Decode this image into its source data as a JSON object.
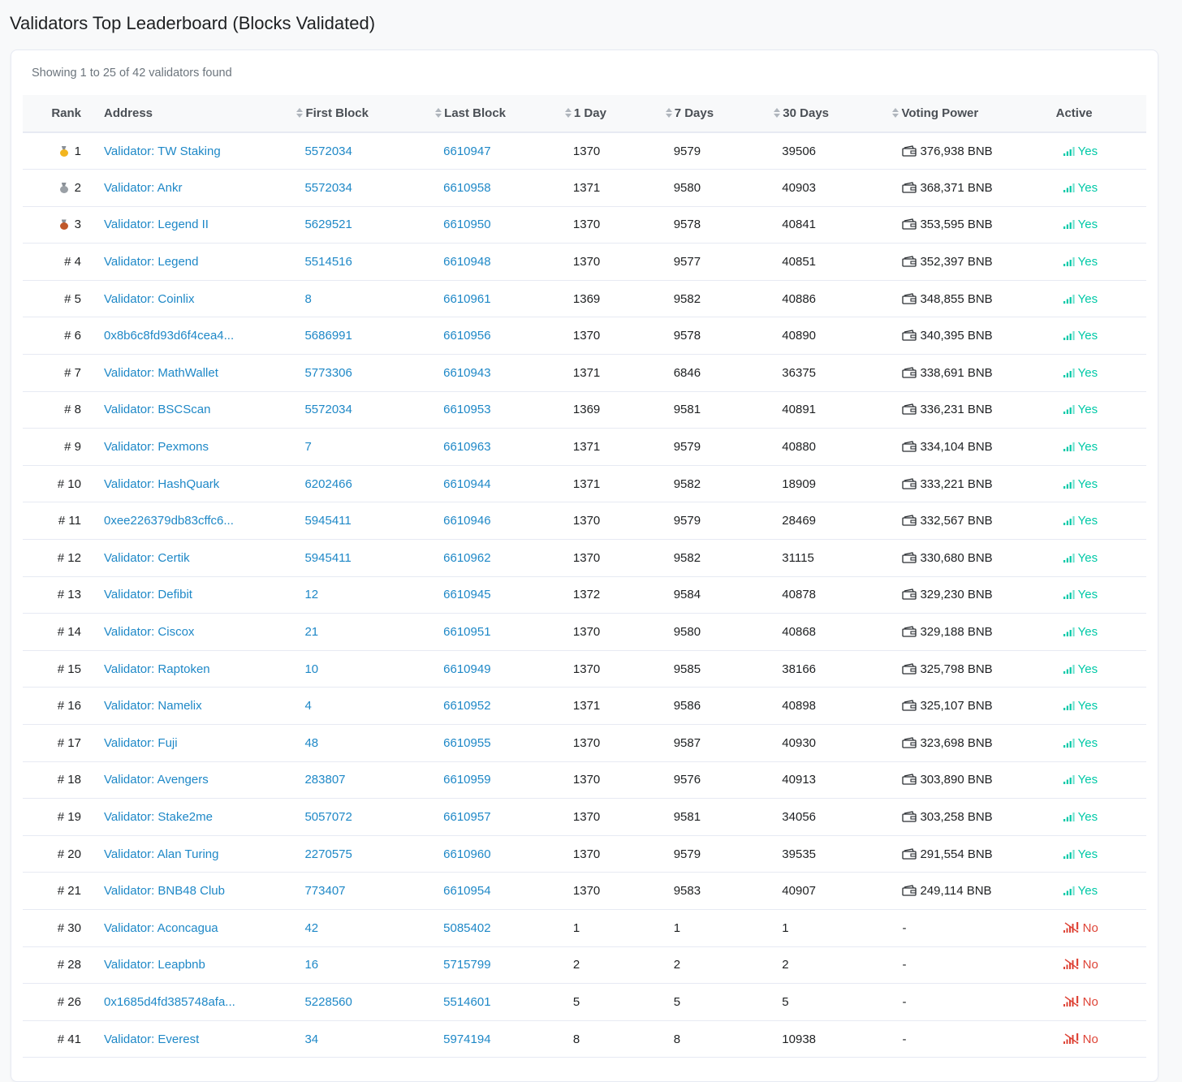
{
  "page": {
    "title": "Validators Top Leaderboard (Blocks Validated)",
    "summary": "Showing 1 to 25 of 42 validators found"
  },
  "colors": {
    "link": "#1e88c7",
    "active_yes": "#00c9a7",
    "active_no": "#de4437",
    "medal_gold": "#f2b51f",
    "medal_silver": "#9aa0a6",
    "medal_bronze": "#c0582a"
  },
  "table": {
    "headers": {
      "rank": "Rank",
      "address": "Address",
      "first_block": "First Block",
      "last_block": "Last Block",
      "day1": "1 Day",
      "day7": "7 Days",
      "day30": "30 Days",
      "voting_power": "Voting Power",
      "active": "Active"
    },
    "rows": [
      {
        "rank": "1",
        "medal": "gold",
        "address": "Validator: TW Staking",
        "first_block": "5572034",
        "last_block": "6610947",
        "day1": "1370",
        "day7": "9579",
        "day30": "39506",
        "voting_power": "376,938 BNB",
        "active": "Yes"
      },
      {
        "rank": "2",
        "medal": "silver",
        "address": "Validator: Ankr",
        "first_block": "5572034",
        "last_block": "6610958",
        "day1": "1371",
        "day7": "9580",
        "day30": "40903",
        "voting_power": "368,371 BNB",
        "active": "Yes"
      },
      {
        "rank": "3",
        "medal": "bronze",
        "address": "Validator: Legend II",
        "first_block": "5629521",
        "last_block": "6610950",
        "day1": "1370",
        "day7": "9578",
        "day30": "40841",
        "voting_power": "353,595 BNB",
        "active": "Yes"
      },
      {
        "rank": "# 4",
        "medal": "",
        "address": "Validator: Legend",
        "first_block": "5514516",
        "last_block": "6610948",
        "day1": "1370",
        "day7": "9577",
        "day30": "40851",
        "voting_power": "352,397 BNB",
        "active": "Yes"
      },
      {
        "rank": "# 5",
        "medal": "",
        "address": "Validator: Coinlix",
        "first_block": "8",
        "last_block": "6610961",
        "day1": "1369",
        "day7": "9582",
        "day30": "40886",
        "voting_power": "348,855 BNB",
        "active": "Yes"
      },
      {
        "rank": "# 6",
        "medal": "",
        "address": "0x8b6c8fd93d6f4cea4...",
        "first_block": "5686991",
        "last_block": "6610956",
        "day1": "1370",
        "day7": "9578",
        "day30": "40890",
        "voting_power": "340,395 BNB",
        "active": "Yes"
      },
      {
        "rank": "# 7",
        "medal": "",
        "address": "Validator: MathWallet",
        "first_block": "5773306",
        "last_block": "6610943",
        "day1": "1371",
        "day7": "6846",
        "day30": "36375",
        "voting_power": "338,691 BNB",
        "active": "Yes"
      },
      {
        "rank": "# 8",
        "medal": "",
        "address": "Validator: BSCScan",
        "first_block": "5572034",
        "last_block": "6610953",
        "day1": "1369",
        "day7": "9581",
        "day30": "40891",
        "voting_power": "336,231 BNB",
        "active": "Yes"
      },
      {
        "rank": "# 9",
        "medal": "",
        "address": "Validator: Pexmons",
        "first_block": "7",
        "last_block": "6610963",
        "day1": "1371",
        "day7": "9579",
        "day30": "40880",
        "voting_power": "334,104 BNB",
        "active": "Yes"
      },
      {
        "rank": "# 10",
        "medal": "",
        "address": "Validator: HashQuark",
        "first_block": "6202466",
        "last_block": "6610944",
        "day1": "1371",
        "day7": "9582",
        "day30": "18909",
        "voting_power": "333,221 BNB",
        "active": "Yes"
      },
      {
        "rank": "# 11",
        "medal": "",
        "address": "0xee226379db83cffc6...",
        "first_block": "5945411",
        "last_block": "6610946",
        "day1": "1370",
        "day7": "9579",
        "day30": "28469",
        "voting_power": "332,567 BNB",
        "active": "Yes"
      },
      {
        "rank": "# 12",
        "medal": "",
        "address": "Validator: Certik",
        "first_block": "5945411",
        "last_block": "6610962",
        "day1": "1370",
        "day7": "9582",
        "day30": "31115",
        "voting_power": "330,680 BNB",
        "active": "Yes"
      },
      {
        "rank": "# 13",
        "medal": "",
        "address": "Validator: Defibit",
        "first_block": "12",
        "last_block": "6610945",
        "day1": "1372",
        "day7": "9584",
        "day30": "40878",
        "voting_power": "329,230 BNB",
        "active": "Yes"
      },
      {
        "rank": "# 14",
        "medal": "",
        "address": "Validator: Ciscox",
        "first_block": "21",
        "last_block": "6610951",
        "day1": "1370",
        "day7": "9580",
        "day30": "40868",
        "voting_power": "329,188 BNB",
        "active": "Yes"
      },
      {
        "rank": "# 15",
        "medal": "",
        "address": "Validator: Raptoken",
        "first_block": "10",
        "last_block": "6610949",
        "day1": "1370",
        "day7": "9585",
        "day30": "38166",
        "voting_power": "325,798 BNB",
        "active": "Yes"
      },
      {
        "rank": "# 16",
        "medal": "",
        "address": "Validator: Namelix",
        "first_block": "4",
        "last_block": "6610952",
        "day1": "1371",
        "day7": "9586",
        "day30": "40898",
        "voting_power": "325,107 BNB",
        "active": "Yes"
      },
      {
        "rank": "# 17",
        "medal": "",
        "address": "Validator: Fuji",
        "first_block": "48",
        "last_block": "6610955",
        "day1": "1370",
        "day7": "9587",
        "day30": "40930",
        "voting_power": "323,698 BNB",
        "active": "Yes"
      },
      {
        "rank": "# 18",
        "medal": "",
        "address": "Validator: Avengers",
        "first_block": "283807",
        "last_block": "6610959",
        "day1": "1370",
        "day7": "9576",
        "day30": "40913",
        "voting_power": "303,890 BNB",
        "active": "Yes"
      },
      {
        "rank": "# 19",
        "medal": "",
        "address": "Validator: Stake2me",
        "first_block": "5057072",
        "last_block": "6610957",
        "day1": "1370",
        "day7": "9581",
        "day30": "34056",
        "voting_power": "303,258 BNB",
        "active": "Yes"
      },
      {
        "rank": "# 20",
        "medal": "",
        "address": "Validator: Alan Turing",
        "first_block": "2270575",
        "last_block": "6610960",
        "day1": "1370",
        "day7": "9579",
        "day30": "39535",
        "voting_power": "291,554 BNB",
        "active": "Yes"
      },
      {
        "rank": "# 21",
        "medal": "",
        "address": "Validator: BNB48 Club",
        "first_block": "773407",
        "last_block": "6610954",
        "day1": "1370",
        "day7": "9583",
        "day30": "40907",
        "voting_power": "249,114 BNB",
        "active": "Yes"
      },
      {
        "rank": "# 30",
        "medal": "",
        "address": "Validator: Aconcagua",
        "first_block": "42",
        "last_block": "5085402",
        "day1": "1",
        "day7": "1",
        "day30": "1",
        "voting_power": "-",
        "active": "No"
      },
      {
        "rank": "# 28",
        "medal": "",
        "address": "Validator: Leapbnb",
        "first_block": "16",
        "last_block": "5715799",
        "day1": "2",
        "day7": "2",
        "day30": "2",
        "voting_power": "-",
        "active": "No"
      },
      {
        "rank": "# 26",
        "medal": "",
        "address": "0x1685d4fd385748afa...",
        "first_block": "5228560",
        "last_block": "5514601",
        "day1": "5",
        "day7": "5",
        "day30": "5",
        "voting_power": "-",
        "active": "No"
      },
      {
        "rank": "# 41",
        "medal": "",
        "address": "Validator: Everest",
        "first_block": "34",
        "last_block": "5974194",
        "day1": "8",
        "day7": "8",
        "day30": "10938",
        "voting_power": "-",
        "active": "No"
      }
    ]
  }
}
